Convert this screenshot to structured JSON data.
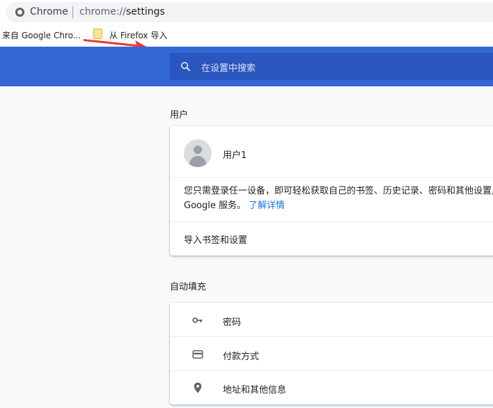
{
  "browser": {
    "site_name": "Chrome",
    "url_scheme": "chrome://",
    "url_host": "settings"
  },
  "bookmarks": {
    "item1": "来自 Google Chro...",
    "item2": "从 Firefox 导入"
  },
  "search": {
    "placeholder": "在设置中搜索"
  },
  "people": {
    "section_title": "用户",
    "user_name": "用户1",
    "desc_line1": "您只需登录任一设备，即可轻松获取自己的书签、历史记录、密码和其他设置,",
    "desc_line2": "Google 服务。",
    "learn_more": "了解详情",
    "import_label": "导入书签和设置"
  },
  "autofill": {
    "section_title": "自动填充",
    "items": [
      {
        "label": "密码",
        "icon": "key-icon"
      },
      {
        "label": "付款方式",
        "icon": "credit-card-icon"
      },
      {
        "label": "地址和其他信息",
        "icon": "location-pin-icon"
      }
    ]
  },
  "colors": {
    "header_blue": "#3367d6",
    "search_box": "#2a56c0",
    "link": "#1a73e8",
    "annotation_arrow": "#e53935"
  }
}
